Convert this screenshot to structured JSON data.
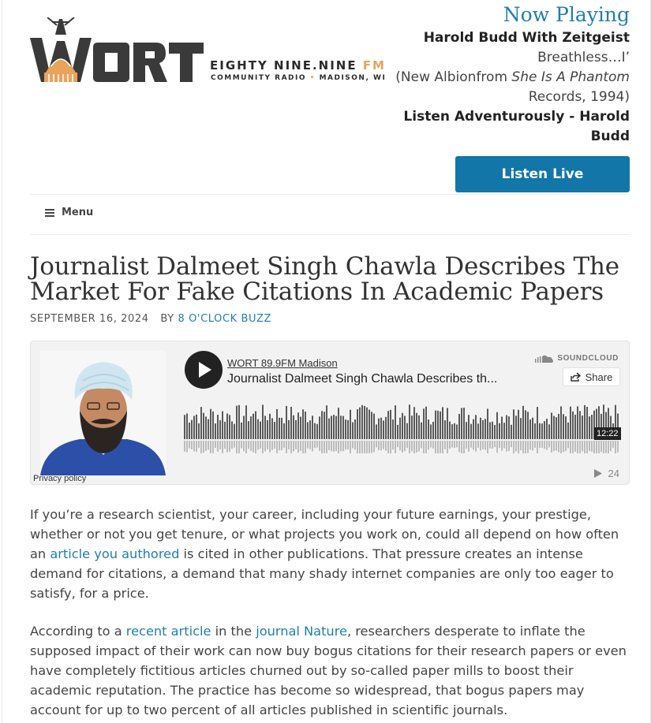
{
  "header": {
    "logo": {
      "wordmark": "WORT",
      "tagline_main": "EIGHTY NINE.NINE",
      "tagline_fm": "FM",
      "tagline_sub_1": "COMMUNITY RADIO",
      "tagline_sub_sep": "•",
      "tagline_sub_2": "MADISON, WI"
    },
    "now_playing": {
      "heading": "Now Playing",
      "artist": "Harold Budd With Zeitgeist",
      "track": "Breathless…I’",
      "label_prefix": "(New Albionfrom ",
      "album": "She Is A Phantom",
      "label_suffix": " Records, 1994)",
      "show": "Listen Adventurously - Harold Budd"
    },
    "listen_live": "Listen Live",
    "menu": "Menu"
  },
  "article": {
    "title": "Journalist Dalmeet Singh Chawla Describes The Market For Fake Citations In Academic Papers",
    "date": "SEPTEMBER 16, 2024",
    "by": "BY",
    "author": "8 O'CLOCK BUZZ"
  },
  "player": {
    "station": "WORT 89.9FM Madison",
    "track": "Journalist Dalmeet Singh Chawla Describes th...",
    "brand": "SOUNDCLOUD",
    "share": "Share",
    "duration": "12:22",
    "plays": "24",
    "privacy": "Privacy policy"
  },
  "body": {
    "p1_a": "If you’re a research scientist, your career, including your future earnings, your prestige, whether or not you get tenure, or what projects you work on, could all depend on how often an ",
    "p1_link": "article you authored",
    "p1_b": " is cited in other publications.  That pressure creates an intense demand for citations, a demand that many shady internet companies are only too eager to satisfy, for a price.",
    "p2_a": "According to a ",
    "p2_link1": "recent article",
    "p2_b": " in the ",
    "p2_link2": "journal Nature",
    "p2_c": ", researchers desperate to inflate the supposed impact of their work can now buy bogus citations for their research papers or even have completely fictitious articles churned out by so-called paper mills to boost their academic reputation.  The practice has become so widespread, that bogus papers may account for up to two percent of all articles published in scientific journals."
  },
  "colors": {
    "accent": "#1f7fb0",
    "button": "#1276a8",
    "logo_dark": "#3a3a3a",
    "logo_orange": "#e8a35c"
  }
}
